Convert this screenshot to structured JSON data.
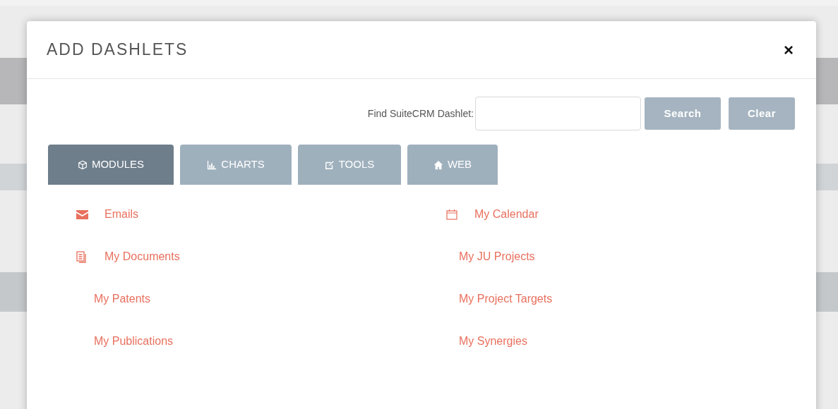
{
  "dialog": {
    "title": "ADD DASHLETS",
    "close": "×"
  },
  "search": {
    "label": "Find SuiteCRM Dashlet:",
    "buttons": [
      "Search",
      "Clear"
    ]
  },
  "tabs": [
    {
      "label": "MODULES",
      "selected": true
    },
    {
      "label": "CHARTS",
      "selected": false
    },
    {
      "label": "TOOLS",
      "selected": false
    },
    {
      "label": "WEB",
      "selected": false
    }
  ],
  "dashlets": [
    {
      "label": "Emails",
      "kind": "email"
    },
    {
      "label": "My Calendar",
      "kind": "calendar"
    },
    {
      "label": "My Documents",
      "kind": "document"
    },
    {
      "label": "My JU Projects",
      "kind": "plain"
    },
    {
      "label": "My Patents",
      "kind": "plain"
    },
    {
      "label": "My Project Targets",
      "kind": "plain"
    },
    {
      "label": "My Publications",
      "kind": "plain"
    },
    {
      "label": "My Synergies",
      "kind": "plain"
    }
  ]
}
